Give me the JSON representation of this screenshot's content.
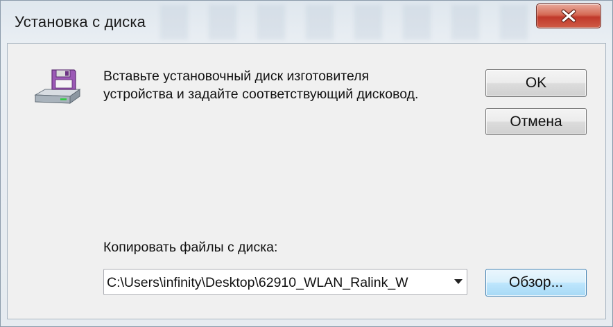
{
  "window": {
    "title": "Установка с диска"
  },
  "icons": {
    "close": "close-icon",
    "disk": "floppy-disk-icon",
    "dropdown": "chevron-down-icon"
  },
  "colors": {
    "close_button": "#c0392b",
    "focused_button_border": "#3c7fb1"
  },
  "dialog": {
    "message_line1": "Вставьте установочный диск изготовителя",
    "message_line2": "устройства и задайте соответствующий дисковод.",
    "copy_from_label": "Копировать файлы с диска:",
    "path_value": "C:\\Users\\infinity\\Desktop\\62910_WLAN_Ralink_W",
    "ok_label": "OK",
    "cancel_label": "Отмена",
    "browse_label": "Обзор..."
  }
}
